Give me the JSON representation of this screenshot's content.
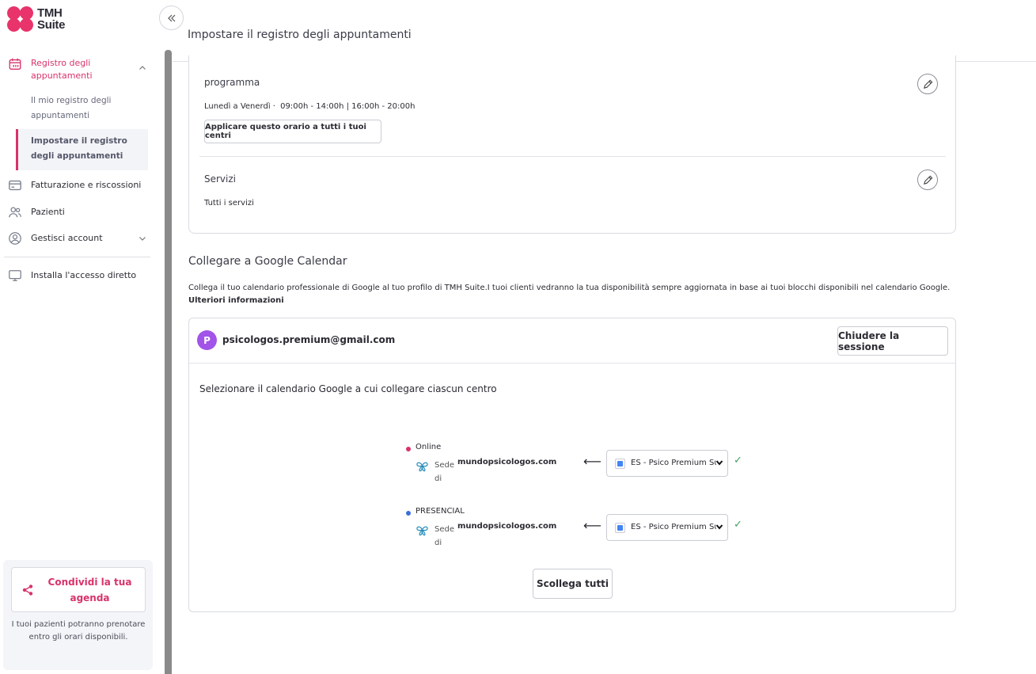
{
  "brand": {
    "line1": "TMH",
    "line2": "Suite",
    "color": "#e8336b"
  },
  "sidebar": {
    "nav": [
      {
        "label": "Registro degli appuntamenti",
        "icon": "calendar-icon",
        "active": true
      },
      {
        "label": "Fatturazione e riscossioni",
        "icon": "credit-card-icon"
      },
      {
        "label": "Pazienti",
        "icon": "users-icon"
      },
      {
        "label": "Gestisci account",
        "icon": "user-circle-icon"
      },
      {
        "label": "Installa l'accesso diretto",
        "icon": "monitor-icon"
      }
    ],
    "sub_items": [
      {
        "label": "Il mio registro degli appuntamenti"
      },
      {
        "label": "Impostare il registro degli appuntamenti",
        "active": true
      }
    ],
    "share": {
      "label": "Condividi la tua agenda",
      "text": "I tuoi pazienti potranno prenotare entro gli orari disponibili."
    }
  },
  "header": {
    "title": "Impostare il registro degli appuntamenti"
  },
  "schedule": {
    "title": "programma",
    "days": "Lunedì a Venerdì",
    "separator": "·",
    "hours": "09:00h - 14:00h |  16:00h - 20:00h",
    "apply_button": "Applicare questo orario a tutti i tuoi centri"
  },
  "services": {
    "title": "Servizi",
    "value": "Tutti i servizi"
  },
  "google_calendar": {
    "title": "Collegare a Google Calendar",
    "description": "Collega il tuo calendario professionale di Google al tuo profilo di TMH Suite.I tuoi clienti vedranno la tua disponibilità sempre aggiornata in base ai tuoi blocchi disponibili nel calendario Google.",
    "more_link": "Ulteriori informazioni",
    "avatar_letter": "P",
    "email": "psicologos.premium@gmail.com",
    "logout_button": "Chiudere la sessione",
    "instruction": "Selezionare il calendario Google a cui collegare ciascun centro",
    "centers": [
      {
        "name": "Online",
        "dot_color": "#d8336a",
        "sede_label": "Sede",
        "sede_name": "mundopsicologos.com",
        "di": "di",
        "arrow": "⟵",
        "calendar": "ES - Psico Premium Suite",
        "check": "✓"
      },
      {
        "name": "PRESENCIAL",
        "dot_color": "#3a6fd8",
        "sede_label": "Sede",
        "sede_name": "mundopsicologos.com",
        "di": "di",
        "arrow": "⟵",
        "calendar": "ES - Psico Premium Suite",
        "check": "✓"
      }
    ],
    "unlink_button": "Scollega tutti"
  },
  "colors": {
    "accent": "#d8336a",
    "border": "#d9dbe1",
    "check": "#3ea35d"
  }
}
